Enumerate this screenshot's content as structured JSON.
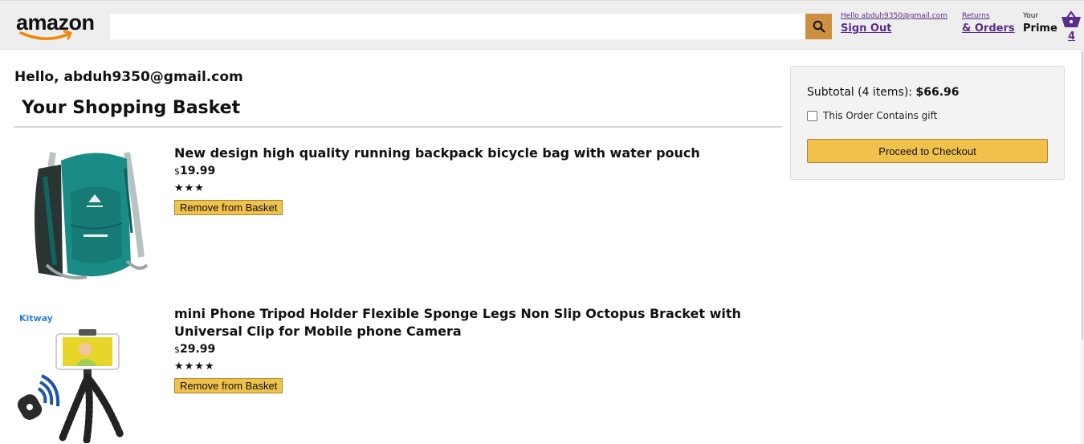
{
  "header": {
    "logo_text": "amazon",
    "search": {
      "value": "",
      "placeholder": ""
    },
    "account": {
      "line_one": "Hello abduh9350@gmail.com",
      "line_two": "Sign Out"
    },
    "orders": {
      "line_one": "Returns",
      "line_two": "& Orders"
    },
    "prime": {
      "line_one": "Your",
      "line_two": "Prime"
    },
    "basket_count": "4"
  },
  "checkout": {
    "greeting": "Hello, abduh9350@gmail.com",
    "title": "Your Shopping Basket",
    "products": [
      {
        "title": "New design high quality running backpack bicycle bag with water pouch",
        "currency": "$",
        "price": "19.99",
        "rating_stars": "★★★",
        "remove_label": "Remove from Basket"
      },
      {
        "title": "mini Phone Tripod Holder Flexible Sponge Legs Non Slip Octopus Bracket with Universal Clip for Mobile phone Camera",
        "currency": "$",
        "price": "29.99",
        "rating_stars": "★★★★",
        "remove_label": "Remove from Basket",
        "image_brand": "Kitway"
      }
    ]
  },
  "subtotal": {
    "label": "Subtotal (4 items): ",
    "value": "$66.96",
    "gift_label": "This Order Contains gift",
    "gift_checked": false,
    "checkout_button": "Proceed to Checkout"
  },
  "colors": {
    "header_bg": "#eeeeee",
    "search_button": "#cd9042",
    "link_purple": "#5a2e88",
    "button_yellow": "#f0c14b",
    "backpack_teal": "#1a8c86"
  },
  "icons": {
    "search": "search-icon",
    "basket": "basket-icon",
    "logo_smile": "amazon-smile-icon"
  }
}
